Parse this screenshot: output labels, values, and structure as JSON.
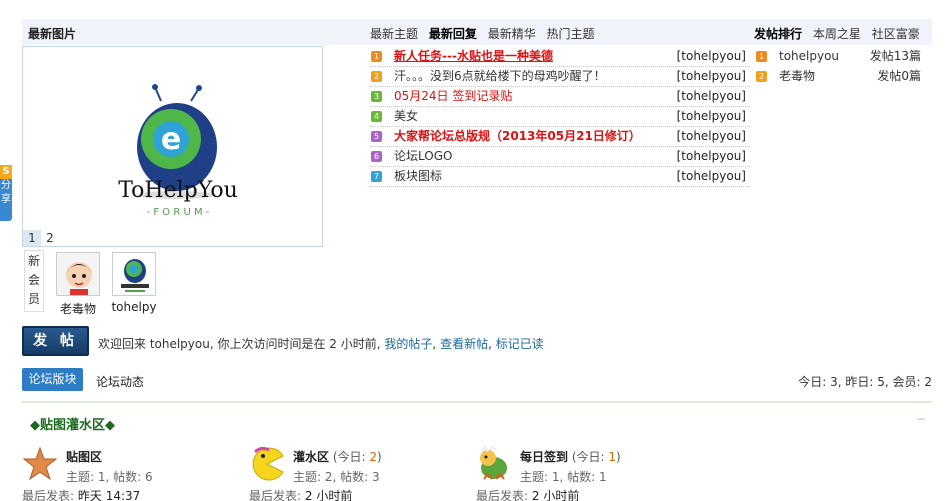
{
  "header": {
    "pictures_title": "最新图片",
    "tabs": [
      {
        "label": "最新主题",
        "active": false
      },
      {
        "label": "最新回复",
        "active": true
      },
      {
        "label": "最新精华",
        "active": false
      },
      {
        "label": "热门主题",
        "active": false
      }
    ],
    "rank_tabs": [
      {
        "label": "发帖排行",
        "active": true
      },
      {
        "label": "本周之星",
        "active": false
      },
      {
        "label": "社区富豪",
        "active": false
      }
    ]
  },
  "photo": {
    "logo_text_main": "ToHelpYou",
    "logo_text_sub": "- F O R U M -",
    "pages": [
      "1",
      "2"
    ],
    "current_page": "1"
  },
  "share": {
    "label_top": "S",
    "label": "分享"
  },
  "new_members": {
    "label": "新会员",
    "members": [
      {
        "name": "老毒物"
      },
      {
        "name": "tohelpy"
      }
    ]
  },
  "threads": [
    {
      "n": "1",
      "color": "#f08a1c",
      "title": "新人任务---水贴也是一种美德",
      "style": "redbu",
      "author": "[tohelpyou]"
    },
    {
      "n": "2",
      "color": "#f0a01c",
      "title": "汗。。。没到6点就给楼下的母鸡吵醒了！",
      "style": "",
      "author": "[tohelpyou]"
    },
    {
      "n": "3",
      "color": "#69b83a",
      "title": "05月24日 签到记录贴",
      "style": "red",
      "author": "[tohelpyou]"
    },
    {
      "n": "4",
      "color": "#69b83a",
      "title": "美女",
      "style": "",
      "author": "[tohelpyou]"
    },
    {
      "n": "5",
      "color": "#a864c8",
      "title": "大家帮论坛总版规（2013年05月21日修订）",
      "style": "redb",
      "author": "[tohelpyou]"
    },
    {
      "n": "6",
      "color": "#a864c8",
      "title": "论坛LOGO",
      "style": "",
      "author": "[tohelpyou]"
    },
    {
      "n": "7",
      "color": "#2fa3d6",
      "title": "板块图标",
      "style": "",
      "author": "[tohelpyou]"
    }
  ],
  "ranks": [
    {
      "n": "1",
      "color": "#f08a1c",
      "name": "tohelpyou",
      "count": "发帖13篇"
    },
    {
      "n": "2",
      "color": "#f0a01c",
      "name": "老毒物",
      "count": "发帖0篇"
    }
  ],
  "actions": {
    "post_button": "发 帖",
    "welcome_text": "欢迎回来 tohelpyou, 你上次访问时间是在 2 小时前,",
    "my_posts": "我的帖子",
    "sep1": ",",
    "new_posts": "查看新帖",
    "sep2": ",",
    "mark_read": "标记已读"
  },
  "forum_tabs": {
    "active": "论坛版块",
    "other": "论坛动态",
    "stats": "今日: 3, 昨日: 5, 会员: 2"
  },
  "section": {
    "title": "◆贴图灌水区◆",
    "collapse": "−",
    "boards": [
      {
        "name": "贴图区",
        "today_prefix": "",
        "today_value": "",
        "today_suffix": "",
        "meta": "主题: 1, 帖数: 6",
        "last_label": "最后发表:",
        "last_value": "昨天 14:37",
        "icon": "starfish-icon"
      },
      {
        "name": "灌水区",
        "today_prefix": " (今日: ",
        "today_value": "2",
        "today_suffix": ")",
        "meta": "主题: 2, 帖数: 3",
        "last_label": "最后发表:",
        "last_value": "2 小时前",
        "icon": "pacman-icon"
      },
      {
        "name": "每日签到",
        "today_prefix": " (今日: ",
        "today_value": "1",
        "today_suffix": ")",
        "meta": "主题: 1, 帖数: 1",
        "last_label": "最后发表:",
        "last_value": "2 小时前",
        "icon": "bowser-icon"
      }
    ]
  }
}
